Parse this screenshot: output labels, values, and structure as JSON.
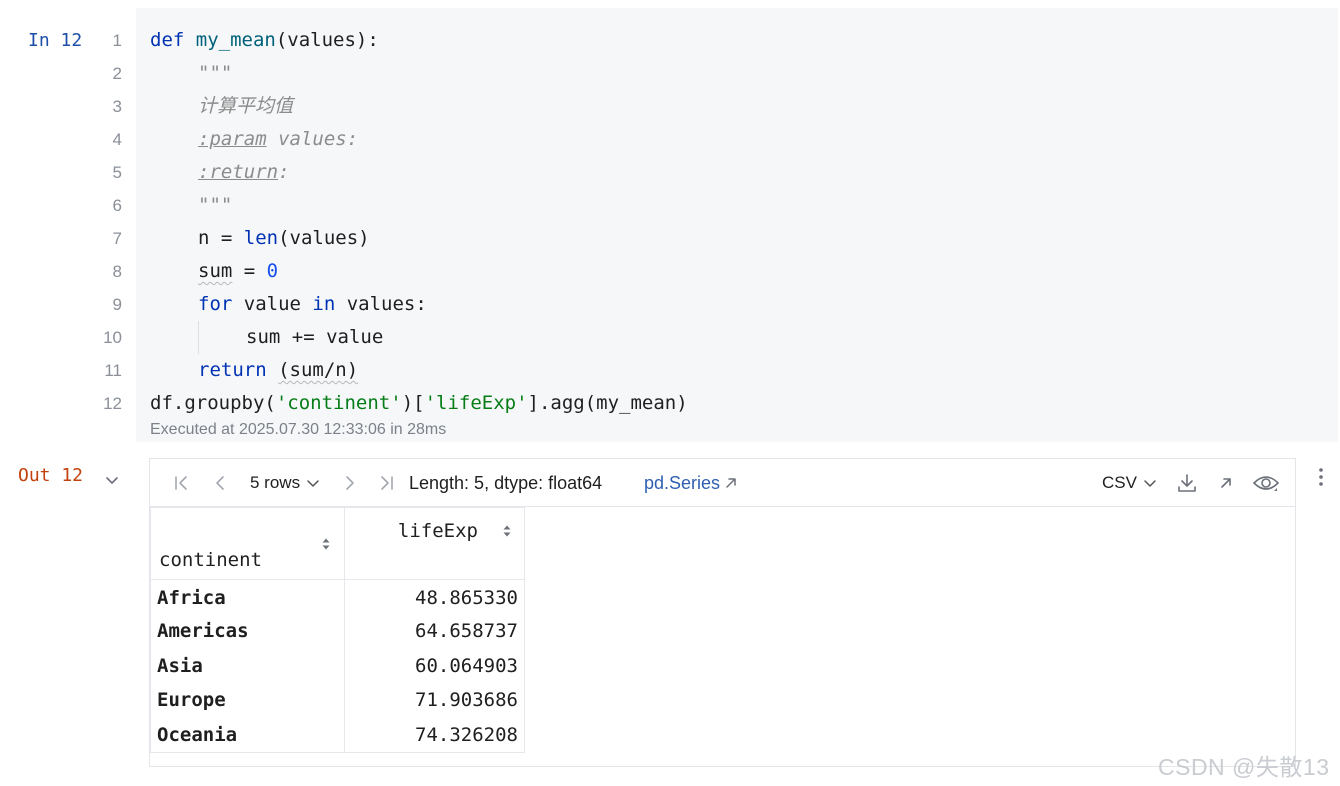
{
  "input_cell": {
    "prompt": "In 12",
    "line_numbers": [
      "1",
      "2",
      "3",
      "4",
      "5",
      "6",
      "7",
      "8",
      "9",
      "10",
      "11",
      "12"
    ],
    "lines": {
      "l1": [
        "def",
        " ",
        "my_mean",
        "(values):"
      ],
      "l2": "\"\"\"",
      "l3": "计算平均值",
      "l4": [
        ":param",
        " values:"
      ],
      "l5": [
        ":return",
        ":"
      ],
      "l6": "\"\"\"",
      "l7": [
        "n = ",
        "len",
        "(values)"
      ],
      "l8": [
        "sum",
        " = ",
        "0"
      ],
      "l9": [
        "for",
        " value ",
        "in",
        " values:"
      ],
      "l10": "sum += value",
      "l11": [
        "return",
        " ",
        "(sum/n)"
      ],
      "l12": [
        "df.groupby(",
        "'continent'",
        ")[",
        "'lifeExp'",
        "].agg(my_mean)"
      ]
    },
    "exec_info": "Executed at 2025.07.30 12:33:06 in 28ms"
  },
  "output_cell": {
    "prompt": "Out 12",
    "toolbar": {
      "rows_label": "5 rows",
      "summary": "Length: 5, dtype: float64",
      "type_link": "pd.Series",
      "export_label": "CSV"
    },
    "table": {
      "headers": [
        "continent",
        "lifeExp"
      ],
      "rows": [
        [
          "Africa",
          "48.865330"
        ],
        [
          "Americas",
          "64.658737"
        ],
        [
          "Asia",
          "60.064903"
        ],
        [
          "Europe",
          "71.903686"
        ],
        [
          "Oceania",
          "74.326208"
        ]
      ]
    }
  },
  "watermark": "CSDN @失散13",
  "colors": {
    "keyword": "#0033b3",
    "function": "#00627a",
    "string": "#067d17",
    "number": "#1750eb",
    "in_prompt": "#1d4fa8",
    "out_prompt": "#c2410c",
    "link": "#2f5fb3"
  },
  "icons": [
    "first-page-icon",
    "prev-page-icon",
    "chevron-down-icon",
    "next-page-icon",
    "last-page-icon",
    "external-link-icon",
    "download-icon",
    "open-in-new-icon",
    "eye-icon",
    "more-vertical-icon",
    "sort-icon",
    "collapse-chevron-icon"
  ]
}
